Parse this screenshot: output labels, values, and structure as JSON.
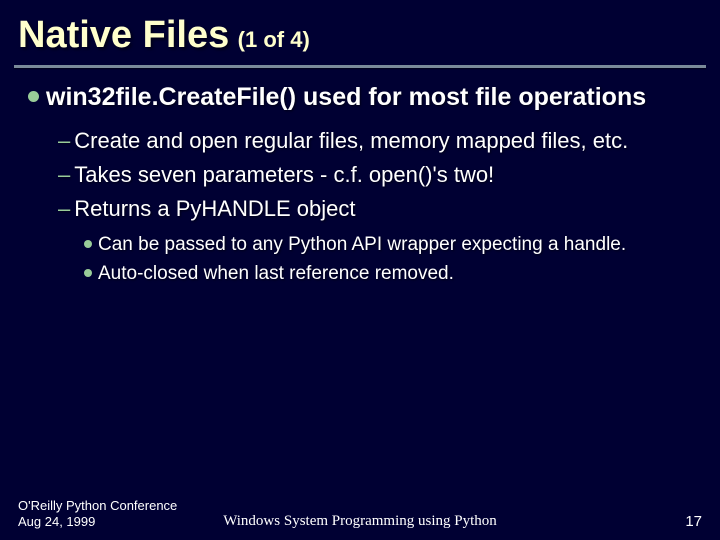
{
  "title": {
    "main": "Native Files",
    "suffix": "(1 of 4)"
  },
  "lvl1": "win32file.CreateFile() used for most file operations",
  "lvl2": [
    "Create and open regular files, memory mapped files, etc.",
    "Takes seven parameters - c.f. open()'s two!",
    "Returns a PyHANDLE object"
  ],
  "lvl3": [
    "Can be passed to any Python API wrapper expecting a handle.",
    "Auto-closed when last reference removed."
  ],
  "footer": {
    "conference": "O'Reilly Python Conference",
    "date": "Aug 24, 1999",
    "center": "Windows System Programming using Python",
    "page": "17"
  }
}
